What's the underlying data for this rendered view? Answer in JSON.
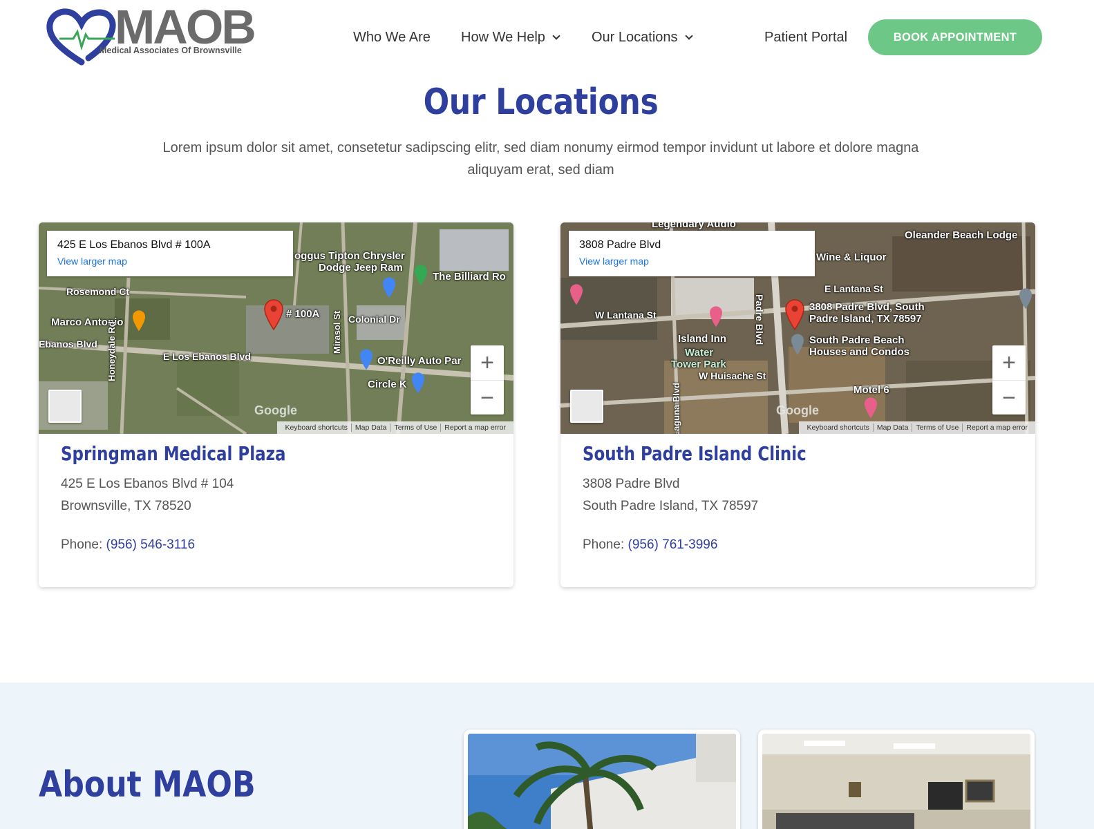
{
  "brand": {
    "name": "MAOB",
    "tagline": "Medical Associates Of Brownsville"
  },
  "nav": {
    "items": [
      {
        "label": "Who We Are"
      },
      {
        "label": "How We Help"
      },
      {
        "label": "Our Locations"
      },
      {
        "label": "Patient Portal"
      }
    ],
    "cta": "BOOK APPOINTMENT"
  },
  "hero": {
    "title": "Our Locations",
    "intro": "Lorem ipsum dolor sit amet, consetetur sadipscing elitr, sed diam nonumy eirmod tempor invidunt ut labore et dolore magna aliquyam erat, sed diam"
  },
  "map_common": {
    "view_larger": "View larger map",
    "google": "Google",
    "attribution": [
      "Keyboard shortcuts",
      "Map Data",
      "Terms of Use",
      "Report a map error"
    ]
  },
  "locations": [
    {
      "map_address": "425 E Los Ebanos Blvd # 100A",
      "map_labels": [
        "oggus Tipton Chrysler",
        "Dodge Jeep Ram",
        "The Billiard Ro",
        "Rosemond Ct",
        "Marco Antonio",
        "# 100A",
        "Colonial Dr",
        "Ebanos Blvd",
        "E Los Ebanos Blvd",
        "O'Reilly Auto Par",
        "Circle K",
        "Honeydale Rd",
        "Mirasol St"
      ],
      "name": "Springman Medical Plaza",
      "address_line1": "425 E Los Ebanos Blvd # 104",
      "address_line2": "Brownsville, TX 78520",
      "phone_label": "Phone:",
      "phone": "(956) 546-3116"
    },
    {
      "map_address": "3808 Padre Blvd",
      "map_labels": [
        "Legendary Audio",
        "Oleander Beach Lodge",
        "Wine & Liquor",
        "E Lantana St",
        "W Lantana St",
        "3808 Padre Blvd, South",
        "Padre Island, TX 78597",
        "Island Inn",
        "Water",
        "Tower Park",
        "South Padre Beach",
        "Houses and Condos",
        "W Huisache St",
        "Motel 6",
        "Padre Blvd",
        "Laguna Blvd"
      ],
      "name": "South Padre Island Clinic",
      "address_line1": "3808 Padre Blvd",
      "address_line2": "South Padre Island, TX 78597",
      "phone_label": "Phone:",
      "phone": "(956) 761-3996"
    }
  ],
  "about": {
    "title": "About MAOB"
  },
  "colors": {
    "brand_blue": "#2e3f9e",
    "cta_green": "#6dc887",
    "band_bg": "#eef5fa"
  }
}
